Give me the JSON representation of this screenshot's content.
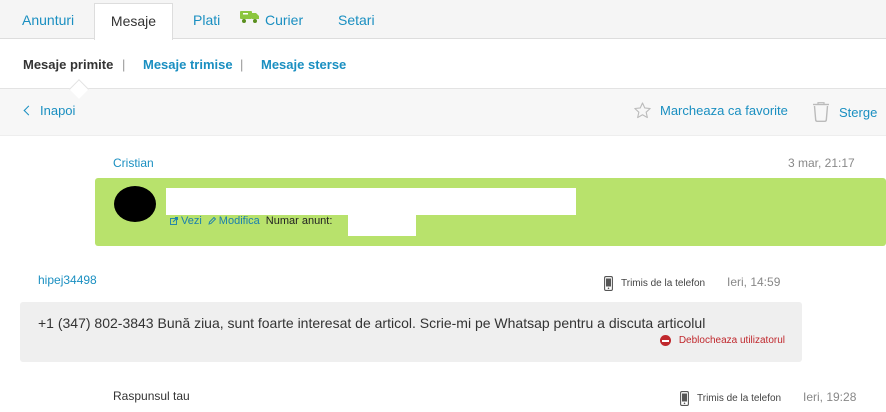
{
  "tabs": [
    {
      "label": "Anunturi"
    },
    {
      "label": "Mesaje"
    },
    {
      "label": "Plati"
    },
    {
      "label": "Curier",
      "icon": "delivery-truck-icon"
    },
    {
      "label": "Setari"
    }
  ],
  "subnav": {
    "items": [
      {
        "label": "Mesaje primite"
      },
      {
        "label": "Mesaje trimise"
      },
      {
        "label": "Mesaje sterse"
      }
    ],
    "separator": "|"
  },
  "toolbar": {
    "back_label": "Inapoi",
    "favorite_label": "Marcheaza ca favorite",
    "delete_label": "Sterge"
  },
  "thread": {
    "listing": {
      "sender": "Cristian",
      "time": "3 mar, 21:17",
      "view_label": "Vezi",
      "edit_label": "Modifica",
      "listing_number_label": "Numar anunt:"
    },
    "message": {
      "sender": "hipej34498",
      "via": "Trimis de la telefon",
      "time": "Ieri, 14:59",
      "text": "+1 (347) 802-3843 Bună ziua, sunt foarte interesat de articol. Scrie-mi pe Whatsap pentru a discuta articolul",
      "block_label": "Deblocheaza utilizatorul"
    },
    "reply": {
      "label": "Raspunsul tau",
      "via": "Trimis de la telefon",
      "time": "Ieri, 19:28"
    }
  },
  "colors": {
    "link": "#1a8fc1",
    "listing_background": "#b8e26c",
    "danger": "#c0282d"
  }
}
